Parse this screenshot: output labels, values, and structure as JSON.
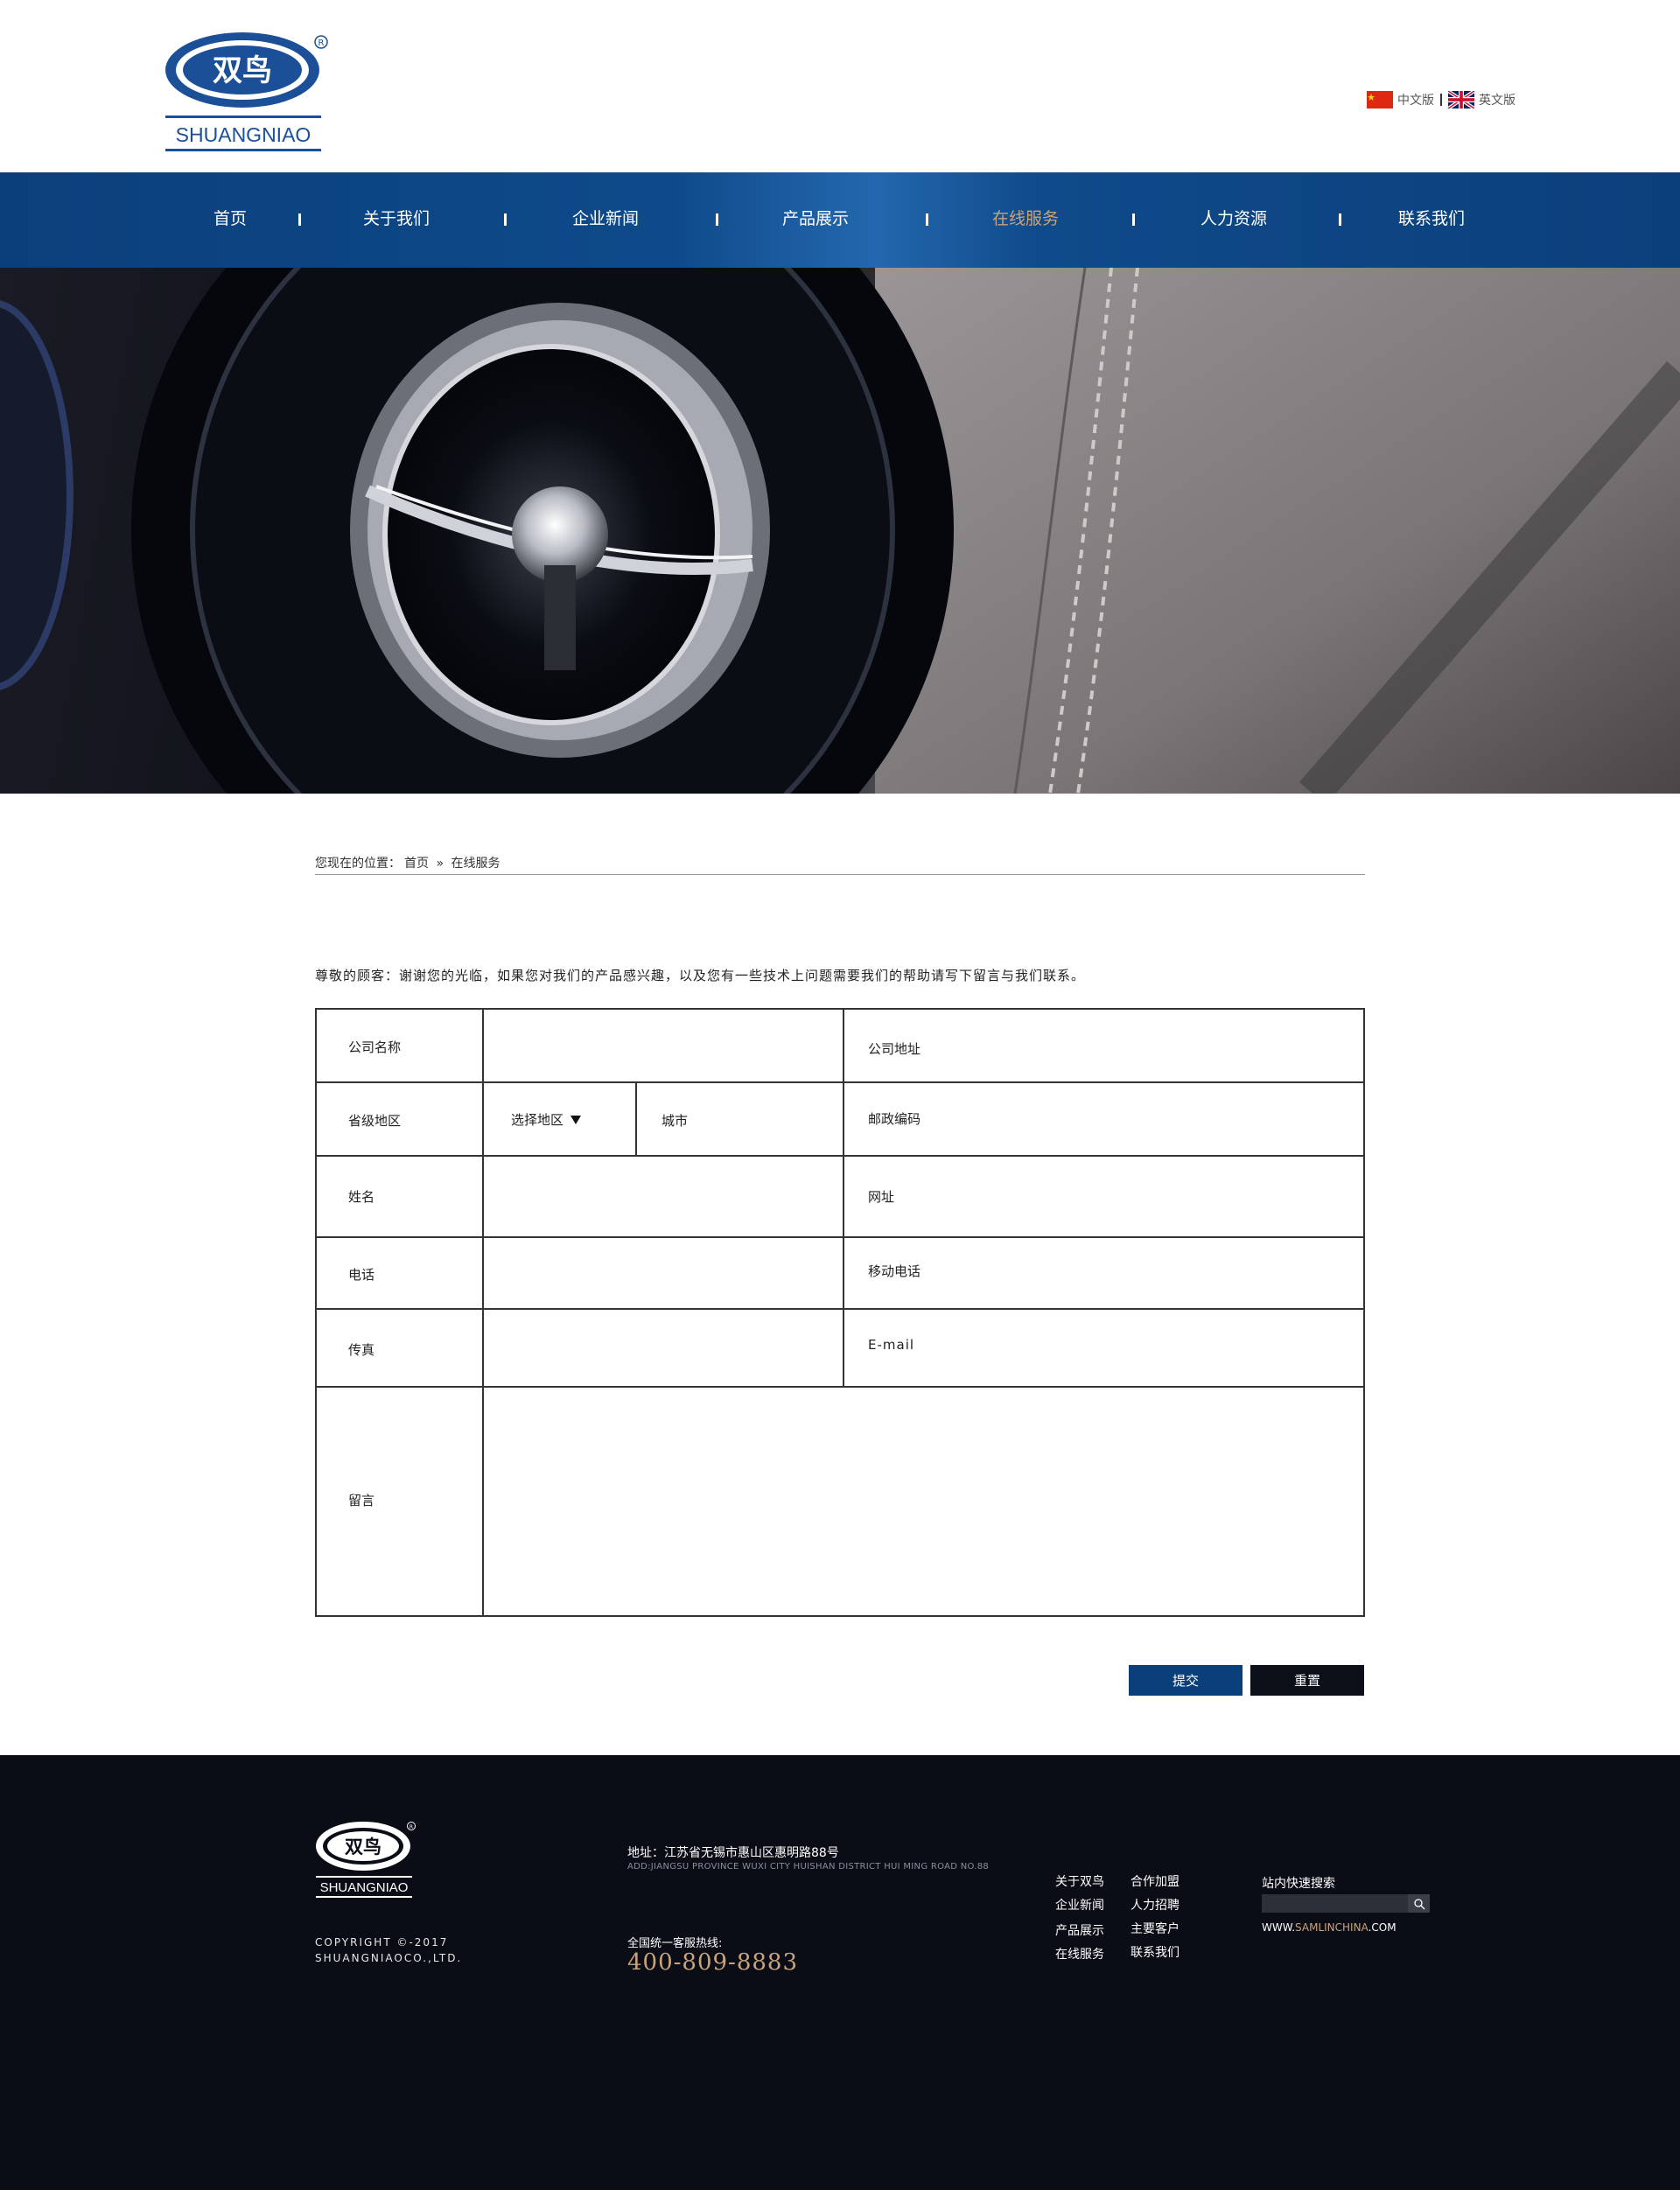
{
  "header": {
    "logo_text": "双鸟",
    "logo_brand": "SHUANGNIAO",
    "lang_cn": "中文版",
    "lang_en": "英文版"
  },
  "nav": {
    "items": [
      {
        "label": "首页"
      },
      {
        "label": "关于我们"
      },
      {
        "label": "企业新闻"
      },
      {
        "label": "产品展示"
      },
      {
        "label": "在线服务",
        "active": true
      },
      {
        "label": "人力资源"
      },
      {
        "label": "联系我们"
      }
    ],
    "active_color": "#c9a37a",
    "bar_color": "#0b3f7c"
  },
  "breadcrumb": {
    "prefix": "您现在的位置：",
    "home": "首页",
    "sep": "»",
    "current": "在线服务"
  },
  "intro": "尊敬的顾客：谢谢您的光临，如果您对我们的产品感兴趣，以及您有一些技术上问题需要我们的帮助请写下留言与我们联系。",
  "form": {
    "company_name": "公司名称",
    "company_address": "公司地址",
    "province": "省级地区",
    "select_region": "选择地区",
    "city": "城市",
    "postcode": "邮政编码",
    "name": "姓名",
    "website": "网址",
    "phone": "电话",
    "mobile": "移动电话",
    "fax": "传真",
    "email": "E-mail",
    "message": "留言",
    "submit": "提交",
    "reset": "重置"
  },
  "footer": {
    "logo_text": "双鸟",
    "logo_brand": "SHUANGNIAO",
    "copyright_line1": "COPYRIGHT ©-2017",
    "copyright_line2": "SHUANGNIAOCO.,LTD.",
    "address_cn": "地址：江苏省无锡市惠山区惠明路88号",
    "address_en": "ADD:JIANGSU PROVINCE WUXI CITY HUISHAN DISTRICT HUI MING ROAD NO.88",
    "hotline_label": "全国统一客服热线:",
    "hotline": "400-809-8883",
    "links": [
      "关于双鸟",
      "合作加盟",
      "企业新闻",
      "人力招聘",
      "产品展示",
      "主要客户",
      "在线服务",
      "联系我们"
    ],
    "search_label": "站内快速搜索",
    "site_prefix": "WWW.",
    "site_name": "SAMLINCHINA",
    "site_suffix": ".COM"
  }
}
